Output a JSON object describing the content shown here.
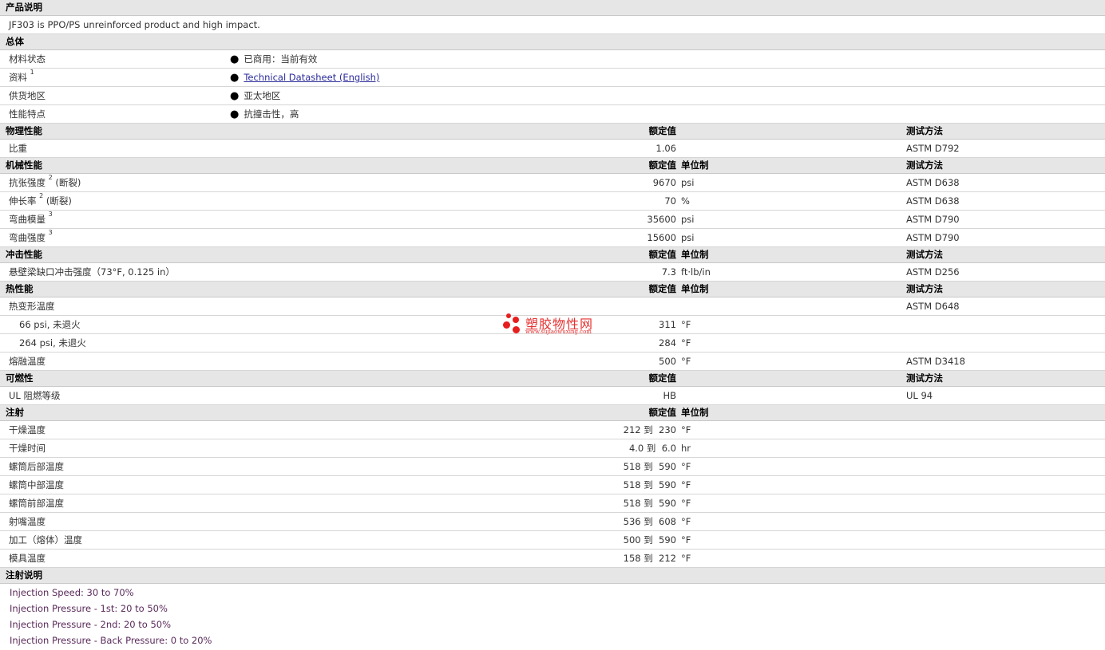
{
  "product_description": {
    "title": "产品说明",
    "text": "JF303 is PPO/PS unreinforced product and high impact."
  },
  "general": {
    "title": "总体",
    "rows": [
      {
        "label": "材料状态",
        "sup": "",
        "value": "已商用：当前有效"
      },
      {
        "label": "资料",
        "sup": "1",
        "value": "Technical Datasheet (English)"
      },
      {
        "label": "供货地区",
        "sup": "",
        "value": "亚太地区"
      },
      {
        "label": "性能特点",
        "sup": "",
        "value": "抗撞击性，高"
      }
    ]
  },
  "physical": {
    "title": "物理性能",
    "h_value": "额定值",
    "h_test": "测试方法",
    "rows": [
      {
        "label": "比重",
        "value": "1.06",
        "test": "ASTM D792"
      }
    ]
  },
  "mechanical": {
    "title": "机械性能",
    "h_value": "额定值",
    "h_unit": "单位制",
    "h_test": "测试方法",
    "rows": [
      {
        "label": "抗张强度",
        "sup": "2",
        "note": "(断裂)",
        "value": "9670",
        "unit": "psi",
        "test": "ASTM D638"
      },
      {
        "label": "伸长率",
        "sup": "2",
        "note": "(断裂)",
        "value": "70",
        "unit": "%",
        "test": "ASTM D638"
      },
      {
        "label": "弯曲模量",
        "sup": "3",
        "note": "",
        "value": "35600",
        "unit": "psi",
        "test": "ASTM D790"
      },
      {
        "label": "弯曲强度",
        "sup": "3",
        "note": "",
        "value": "15600",
        "unit": "psi",
        "test": "ASTM D790"
      }
    ]
  },
  "impact": {
    "title": "冲击性能",
    "h_value": "额定值",
    "h_unit": "单位制",
    "h_test": "测试方法",
    "rows": [
      {
        "label": "悬壁梁缺口冲击强度（73°F, 0.125 in）",
        "value": "7.3",
        "unit": "ft·lb/in",
        "test": "ASTM D256"
      }
    ]
  },
  "thermal": {
    "title": "热性能",
    "h_value": "额定值",
    "h_unit": "单位制",
    "h_test": "测试方法",
    "rows": [
      {
        "label": "热变形温度",
        "indent": false,
        "value": "",
        "unit": "",
        "test": "ASTM D648"
      },
      {
        "label": "66 psi, 未退火",
        "indent": true,
        "value": "311",
        "unit": "°F",
        "test": ""
      },
      {
        "label": "264 psi, 未退火",
        "indent": true,
        "value": "284",
        "unit": "°F",
        "test": ""
      },
      {
        "label": "熔融温度",
        "indent": false,
        "value": "500",
        "unit": "°F",
        "test": "ASTM D3418"
      }
    ]
  },
  "flammability": {
    "title": "可燃性",
    "h_value": "额定值",
    "h_test": "测试方法",
    "rows": [
      {
        "label": "UL 阻燃等级",
        "value": "HB",
        "test": "UL 94"
      }
    ]
  },
  "injection": {
    "title": "注射",
    "h_value": "额定值",
    "h_unit": "单位制",
    "rows": [
      {
        "label": "干燥温度",
        "from": "212",
        "to_word": "到",
        "to": "230",
        "unit": "°F"
      },
      {
        "label": "干燥时间",
        "from": "4.0",
        "to_word": "到",
        "to": "6.0",
        "unit": "hr"
      },
      {
        "label": "螺筒后部温度",
        "from": "518",
        "to_word": "到",
        "to": "590",
        "unit": "°F"
      },
      {
        "label": "螺筒中部温度",
        "from": "518",
        "to_word": "到",
        "to": "590",
        "unit": "°F"
      },
      {
        "label": "螺筒前部温度",
        "from": "518",
        "to_word": "到",
        "to": "590",
        "unit": "°F"
      },
      {
        "label": "射嘴温度",
        "from": "536",
        "to_word": "到",
        "to": "608",
        "unit": "°F"
      },
      {
        "label": "加工（熔体）温度",
        "from": "500",
        "to_word": "到",
        "to": "590",
        "unit": "°F"
      },
      {
        "label": "模具温度",
        "from": "158",
        "to_word": "到",
        "to": "212",
        "unit": "°F"
      }
    ]
  },
  "injection_notes": {
    "title": "注射说明",
    "lines": [
      "Injection Speed: 30 to 70%",
      "Injection Pressure - 1st: 20 to 50%",
      "Injection Pressure - 2nd: 20 to 50%",
      "Injection Pressure - Back Pressure: 0 to 20%"
    ]
  },
  "watermark": {
    "text": "塑胶物性网",
    "url": "www.sujiaowuxing.com"
  }
}
